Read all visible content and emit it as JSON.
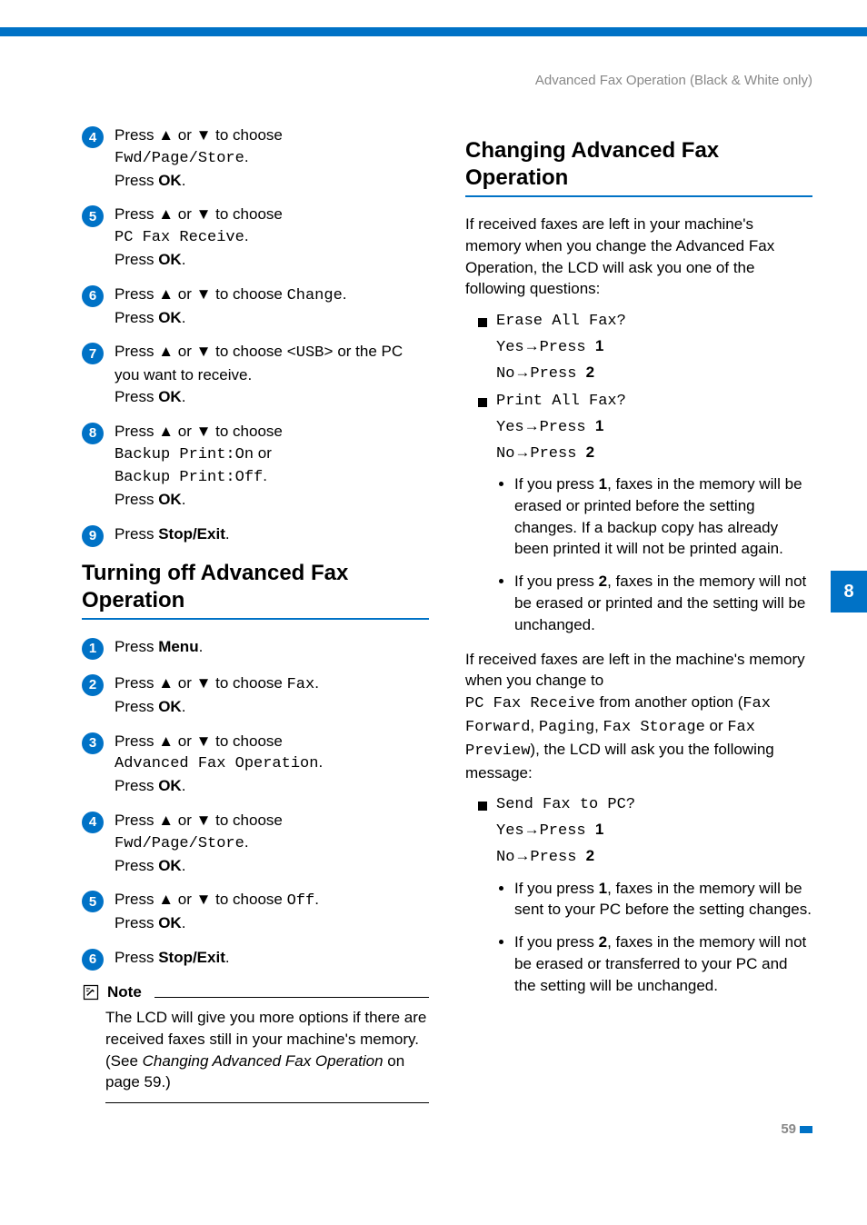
{
  "header": {
    "breadcrumb": "Advanced Fax Operation (Black & White only)"
  },
  "side_tab": "8",
  "page_number": "59",
  "left": {
    "stepsA": [
      {
        "n": "4",
        "pre": "Press ",
        "mid": " or ",
        "post": " to choose ",
        "mono": "Fwd/Page/Store",
        "tail": ".",
        "ok": "Press ",
        "okb": "OK",
        "okdot": "."
      },
      {
        "n": "5",
        "pre": "Press ",
        "mid": " or ",
        "post": " to choose ",
        "mono": "PC Fax Receive",
        "tail": ".",
        "ok": "Press ",
        "okb": "OK",
        "okdot": "."
      },
      {
        "n": "6",
        "pre": "Press ",
        "mid": " or ",
        "post": " to choose ",
        "mono": "Change",
        "tail": ".",
        "ok": "Press ",
        "okb": "OK",
        "okdot": "."
      },
      {
        "n": "7",
        "pre": "Press ",
        "mid": " or ",
        "post": " to choose ",
        "mono": "<USB>",
        "tail": " or the PC you want to receive.",
        "ok": "Press ",
        "okb": "OK",
        "okdot": "."
      },
      {
        "n": "8",
        "pre": "Press ",
        "mid": " or ",
        "post": " to choose ",
        "mono": "Backup Print:On",
        "between": " or ",
        "mono2": "Backup Print:Off",
        "tail": ".",
        "ok": "Press ",
        "okb": "OK",
        "okdot": "."
      },
      {
        "n": "9",
        "plain_pre": "Press ",
        "plain_b": "Stop/Exit",
        "plain_post": "."
      }
    ],
    "heading_turn_off": "Turning off Advanced Fax Operation",
    "stepsB": [
      {
        "n": "1",
        "plain_pre": "Press ",
        "plain_b": "Menu",
        "plain_post": "."
      },
      {
        "n": "2",
        "pre": "Press ",
        "mid": " or ",
        "post": " to choose ",
        "mono": "Fax",
        "tail": ".",
        "ok": "Press ",
        "okb": "OK",
        "okdot": "."
      },
      {
        "n": "3",
        "pre": "Press ",
        "mid": " or ",
        "post": " to choose ",
        "mono": "Advanced Fax Operation",
        "tail": ".",
        "ok": "Press ",
        "okb": "OK",
        "okdot": "."
      },
      {
        "n": "4",
        "pre": "Press ",
        "mid": " or ",
        "post": " to choose ",
        "mono": "Fwd/Page/Store",
        "tail": ".",
        "ok": "Press ",
        "okb": "OK",
        "okdot": "."
      },
      {
        "n": "5",
        "pre": "Press ",
        "mid": " or ",
        "post": " to choose ",
        "mono": "Off",
        "tail": ".",
        "ok": "Press ",
        "okb": "OK",
        "okdot": "."
      },
      {
        "n": "6",
        "plain_pre": "Press ",
        "plain_b": "Stop/Exit",
        "plain_post": "."
      }
    ],
    "note_label": "Note",
    "note_body_1": "The LCD will give you more options if there are received faxes still in your machine's memory. (See ",
    "note_body_em": "Changing Advanced Fax Operation",
    "note_body_2": " on page 59.)"
  },
  "right": {
    "heading_change": "Changing Advanced Fax Operation",
    "intro": "If received faxes are left in your machine's memory when you change the Advanced Fax Operation, the LCD will ask you one of the following questions:",
    "q1": "Erase All Fax?",
    "yes": "Yes",
    "press": "Press ",
    "one": "1",
    "no": "No",
    "two": "2",
    "q2": "Print All Fax?",
    "bullets1": [
      {
        "pre": "If you press ",
        "b": "1",
        "post": ", faxes in the memory will be erased or printed before the setting changes. If a backup copy has already been printed it will not be printed again."
      },
      {
        "pre": "If you press ",
        "b": "2",
        "post": ", faxes in the memory will not be erased or printed and the setting will be unchanged."
      }
    ],
    "para2a": "If received faxes are left in the machine's memory when you change to ",
    "para2_mono1": "PC Fax Receive",
    "para2b": " from another option (",
    "para2_mono2": "Fax Forward",
    "c1": ", ",
    "para2_mono3": "Paging",
    "c2": ", ",
    "para2_mono4": "Fax Storage",
    "para2c": " or ",
    "para2_mono5": "Fax Preview",
    "para2d": "), the LCD will ask you the following message:",
    "q3": "Send Fax to PC?",
    "bullets2": [
      {
        "pre": "If you press ",
        "b": "1",
        "post": ", faxes in the memory will be sent to your PC before the setting changes."
      },
      {
        "pre": "If you press ",
        "b": "2",
        "post": ", faxes in the memory will not be erased or transferred to your PC and the setting will be unchanged."
      }
    ]
  }
}
